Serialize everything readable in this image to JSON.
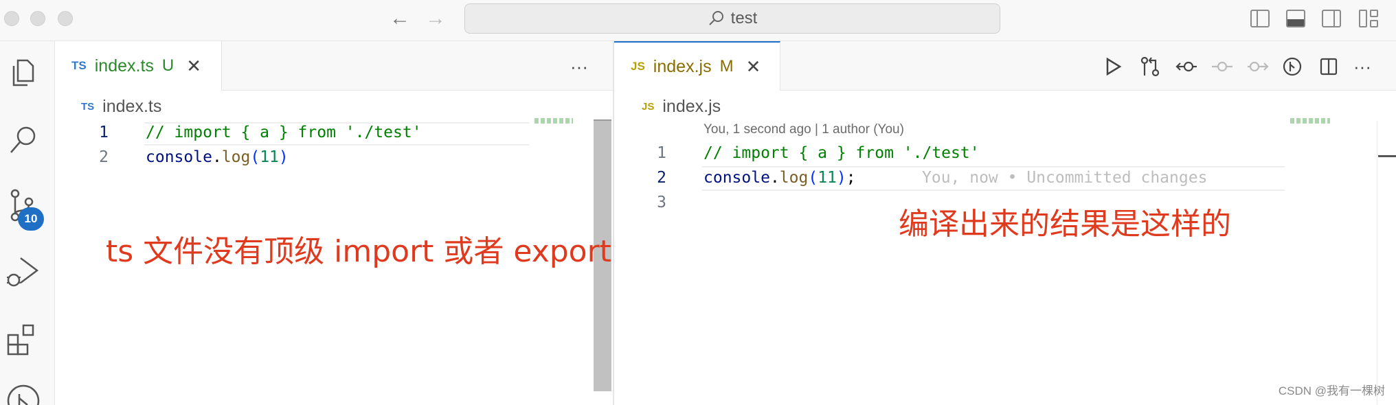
{
  "titlebar": {
    "search_text": "test",
    "nav_back": "←",
    "nav_forward": "→"
  },
  "activity": {
    "items": [
      "explorer-icon",
      "search-icon",
      "source-control-icon",
      "run-debug-icon",
      "extensions-icon",
      "git-graph-icon"
    ],
    "scm_badge": "10"
  },
  "left_editor": {
    "tab": {
      "lang": "TS",
      "name": "index.ts",
      "status": "U",
      "close": "✕",
      "lang_color": "#3178c6",
      "name_color": "#2a8a2a"
    },
    "more": "···",
    "breadcrumb": {
      "lang": "TS",
      "name": "index.ts"
    },
    "lines": [
      {
        "num": "1",
        "comment": "// import { a } from './test'"
      },
      {
        "num": "2",
        "obj": "console",
        "dot": ".",
        "fn": "log",
        "open": "(",
        "arg": "11",
        "close": ")",
        "semi": ""
      }
    ],
    "annotation": "ts 文件没有顶级 import 或者 export"
  },
  "right_editor": {
    "tab": {
      "lang": "JS",
      "name": "index.js",
      "status": "M",
      "close": "✕",
      "lang_color": "#b8a000",
      "name_color": "#8a6d00"
    },
    "more": "···",
    "breadcrumb": {
      "lang": "JS",
      "name": "index.js"
    },
    "blame_header": "You, 1 second ago | 1 author (You)",
    "lines": [
      {
        "num": "1",
        "comment": "// import { a } from './test'"
      },
      {
        "num": "2",
        "obj": "console",
        "dot": ".",
        "fn": "log",
        "open": "(",
        "arg": "11",
        "close": ")",
        "semi": ";"
      },
      {
        "num": "3"
      }
    ],
    "inline_blame": "You, now • Uncommitted changes",
    "annotation": "编译出来的结果是这样的"
  },
  "watermark": "CSDN @我有一棵树"
}
